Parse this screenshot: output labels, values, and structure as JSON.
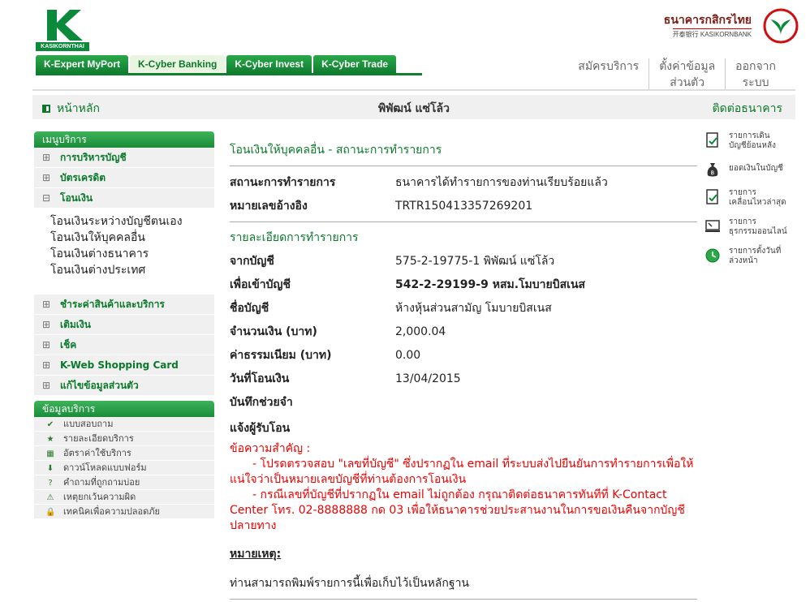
{
  "brand": {
    "logo_text": "KASIKORNTHAI",
    "bank_name_th": "ธนาคารกสิกรไทย",
    "bank_name_en": "开泰银行 KASIKORNBANK",
    "colors": {
      "green": "#0a7a2a",
      "red": "#e00000"
    }
  },
  "tabs": [
    {
      "label": "K-Expert MyPort"
    },
    {
      "label": "K-Cyber Banking"
    },
    {
      "label": "K-Cyber Invest"
    },
    {
      "label": "K-Cyber Trade"
    }
  ],
  "topnav": {
    "register": "สมัครบริการ",
    "settings_1": "ตั้งค่าข้อมูล",
    "settings_2": "ส่วนตัว",
    "logout_1": "ออกจาก",
    "logout_2": "ระบบ"
  },
  "bar": {
    "home": "หน้าหลัก",
    "user": "พิพัฒน์ แซ่โล้ว",
    "contact": "ติดต่อธนาคาร"
  },
  "sidebar": {
    "menu_title": "เมนูบริการ",
    "items_top": [
      {
        "pm": "⊞",
        "label": "การบริหารบัญชี"
      },
      {
        "pm": "⊞",
        "label": "บัตรเครดิต"
      },
      {
        "pm": "⊟",
        "label": "โอนเงิน"
      }
    ],
    "submenu": [
      "โอนเงินระหว่างบัญชีตนเอง",
      "โอนเงินให้บุคคลอื่น",
      "โอนเงินต่างธนาคาร",
      "โอนเงินต่างประเทศ"
    ],
    "items_bottom": [
      {
        "pm": "⊞",
        "label": "ชำระค่าสินค้าและบริการ"
      },
      {
        "pm": "⊞",
        "label": "เติมเงิน"
      },
      {
        "pm": "⊞",
        "label": "เช็ค"
      },
      {
        "pm": "⊞",
        "label": "K-Web Shopping Card"
      },
      {
        "pm": "⊞",
        "label": "แก้ไขข้อมูลส่วนตัว"
      }
    ],
    "info_title": "ข้อมูลบริการ",
    "info_items": [
      {
        "icon": "✔",
        "label": "แบบสอบถาม"
      },
      {
        "icon": "★",
        "label": "รายละเอียดบริการ"
      },
      {
        "icon": "▦",
        "label": "อัตราค่าใช้บริการ"
      },
      {
        "icon": "⬇",
        "label": "ดาวน์โหลดแบบฟอร์ม"
      },
      {
        "icon": "?",
        "label": "คำถามที่ถูกถามบ่อย"
      },
      {
        "icon": "⚠",
        "label": "เหตุยกเว้นความผิด"
      },
      {
        "icon": "🔒",
        "label": "เทคนิคเพื่อความปลอดภัย"
      }
    ]
  },
  "main": {
    "title": "โอนเงินให้บุคคลอื่น - สถานะการทำรายการ",
    "status_label": "สถานะการทำรายการ",
    "status_value": "ธนาคารได้ทำรายการของท่านเรียบร้อยแล้ว",
    "ref_label": "หมายเลขอ้างอิง",
    "ref_value": "TRTR150413357269201",
    "details_title": "รายละเอียดการทำรายการ",
    "from_label": "จากบัญชี",
    "from_value": "575-2-19775-1 พิพัฒน์ แซ่โล้ว",
    "to_label": "เพื่อเข้าบัญชี",
    "to_value": "542-2-29199-9 หสม.โมบายบิสเนส",
    "name_label": "ชื่อบัญชี",
    "name_value": "ห้างหุ้นส่วนสามัญ โมบายบิสเนส",
    "amount_label": "จำนวนเงิน (บาท)",
    "amount_value": "2,000.04",
    "fee_label": "ค่าธรรมเนียม (บาท)",
    "fee_value": "0.00",
    "date_label": "วันที่โอนเงิน",
    "date_value": "13/04/2015",
    "memo_label": "บันทึกช่วยจำ",
    "notify_label": "แจ้งผู้รับโอน",
    "important_title": "ข้อความสำคัญ :",
    "important_1": "- โปรดตรวจสอบ \"เลขที่บัญชี\" ซึ่งปรากฏใน email ที่ระบบส่งไปยืนยันการทำรายการเพื่อให้แน่ใจว่าเป็นหมายเลขบัญชีที่ท่านต้องการโอนเงิน",
    "important_2": "- กรณีเลขที่บัญชีที่ปรากฏใน email ไม่ถูกต้อง กรุณาติดต่อธนาคารทันทีที่ K-Contact Center โทร. 02-8888888 กด 03 เพื่อให้ธนาคารช่วยประสานงานในการขอเงินคืนจากบัญชีปลายทาง",
    "note_title": "หมายเหตุ:",
    "note_text": "ท่านสามารถพิมพ์รายการนี้เพื่อเก็บไว้เป็นหลักฐาน"
  },
  "rail": [
    {
      "icon": "statement-icon",
      "line1": "รายการเดิน",
      "line2": "บัญชีย้อนหลัง"
    },
    {
      "icon": "money-bag-icon",
      "line1": "ยอดเงินในบัญชี",
      "line2": ""
    },
    {
      "icon": "movement-icon",
      "line1": "รายการ",
      "line2": "เคลื่อนไหวล่าสุด"
    },
    {
      "icon": "online-transaction-icon",
      "line1": "รายการ",
      "line2": "ธุรกรรมออนไลน์"
    },
    {
      "icon": "scheduled-icon",
      "line1": "รายการตั้งวันที่",
      "line2": "ล่วงหน้า"
    }
  ]
}
